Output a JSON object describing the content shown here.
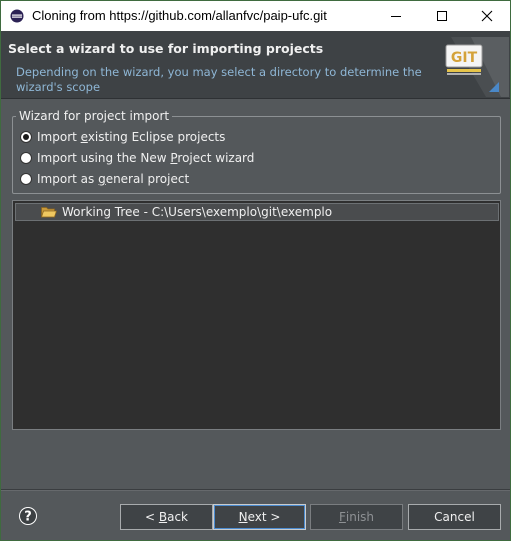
{
  "window": {
    "title": "Cloning from https://github.com/allanfvc/paip-ufc.git"
  },
  "banner": {
    "title": "Select a wizard to use for importing projects",
    "description": "Depending on the wizard, you may select a directory to determine the wizard's scope",
    "logo_text": "GIT"
  },
  "wizard_group": {
    "legend": "Wizard for project import",
    "options": [
      {
        "pre": "Import ",
        "mnemonic": "e",
        "post": "xisting Eclipse projects",
        "checked": true
      },
      {
        "pre": "Import using the New ",
        "mnemonic": "P",
        "post": "roject wizard",
        "checked": false
      },
      {
        "pre": "Import as ",
        "mnemonic": "g",
        "post": "eneral project",
        "checked": false
      }
    ]
  },
  "tree": {
    "items": [
      {
        "label": "Working Tree - C:\\Users\\exemplo\\git\\exemplo",
        "icon": "open-folder-icon"
      }
    ]
  },
  "buttons": {
    "back": {
      "pre": "< ",
      "mnemonic": "B",
      "post": "ack"
    },
    "next": {
      "pre": "",
      "mnemonic": "N",
      "post": "ext >"
    },
    "finish": {
      "pre": "",
      "mnemonic": "F",
      "post": "inish"
    },
    "cancel": {
      "label": "Cancel"
    }
  },
  "colors": {
    "background": "#54585b",
    "banner": "#3e4245",
    "description_text": "#8fb7d6",
    "tree_background": "#2f2f2f"
  }
}
